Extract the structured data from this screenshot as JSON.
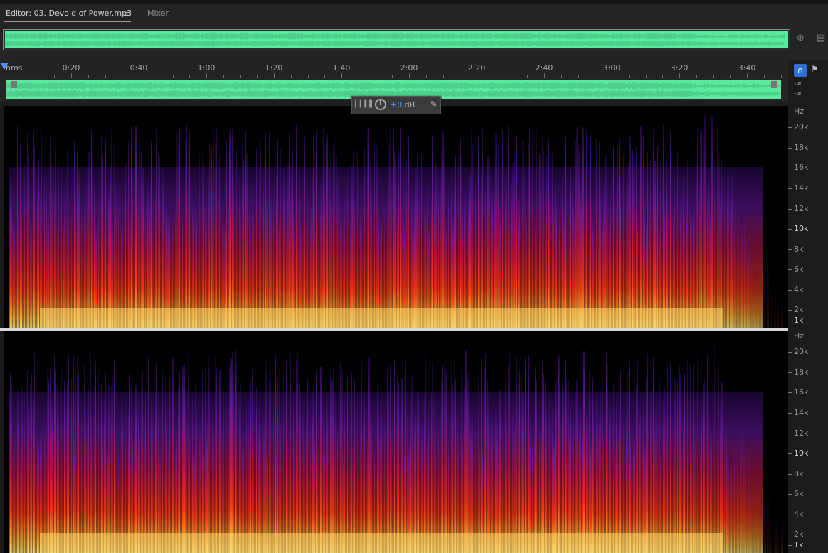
{
  "tabs": {
    "editor_label": "Editor: 03. Devoid of Power.mp3",
    "menu_icon": "≡",
    "mixer_label": "Mixer"
  },
  "ruler": {
    "unit_label": "hms",
    "ticks": [
      "0:20",
      "0:40",
      "1:00",
      "1:20",
      "1:40",
      "2:00",
      "2:20",
      "2:40",
      "3:00",
      "3:20",
      "3:40"
    ]
  },
  "meters": {
    "left_db": "-∞",
    "right_db": "-∞"
  },
  "hud": {
    "value": "+0",
    "unit": " dB"
  },
  "frequency_axis": {
    "unit": "Hz",
    "labels": [
      "20k",
      "18k",
      "16k",
      "14k",
      "12k",
      "10k",
      "8k",
      "6k",
      "4k",
      "2k",
      "1k"
    ],
    "bold": [
      "10k",
      "1k"
    ]
  },
  "colors": {
    "waveform": "#5be9a0",
    "accent": "#4b8eff",
    "spectrum_low": "#ffe27a",
    "spectrum_mid": "#ff3a12",
    "spectrum_high": "#6a1aa8"
  },
  "icons": {
    "zoom": "zoom-icon",
    "panel": "panel-icon",
    "magnet": "snap-magnet-icon",
    "marker": "marker-flag-icon",
    "pin": "pin-icon",
    "level": "level-knob-icon"
  }
}
